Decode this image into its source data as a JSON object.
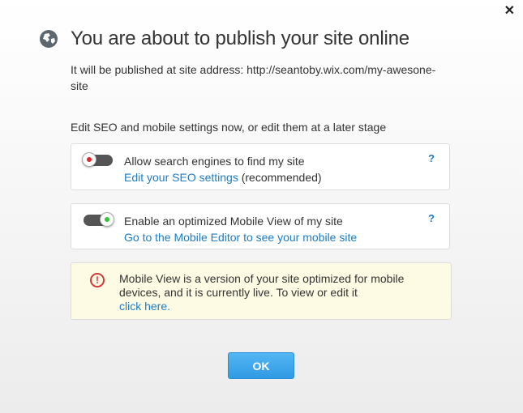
{
  "dialog": {
    "close_label": "✕",
    "title": "You are about to publish your site online",
    "address_text": "It will be published at site address: http://seantoby.wix.com/my-awesone-site",
    "intro": "Edit SEO and mobile settings now, or edit them at a later stage"
  },
  "seo": {
    "toggle_state": "off",
    "label": "Allow search engines to find my site",
    "link": "Edit your SEO settings",
    "suffix": " (recommended)",
    "help": "?"
  },
  "mobile": {
    "toggle_state": "on",
    "label": "Enable an optimized Mobile View of my site",
    "link": "Go to the Mobile Editor to see your mobile site",
    "help": "?"
  },
  "notice": {
    "icon": "!",
    "text": "Mobile View is a version of your site optimized for mobile devices, and it is currently live. To view or edit it",
    "link": "click here."
  },
  "ok_label": "OK",
  "colors": {
    "link": "#1e7cc6",
    "toggle_off_dot": "#e0262b",
    "toggle_on_dot": "#39c13c",
    "button": "#3aa3ea",
    "notice_bg": "#fdfbe4",
    "warning": "#d23a3a"
  },
  "icons": {
    "title_icon": "globe-icon",
    "close_icon": "close-icon",
    "warning_icon": "warning-icon"
  }
}
